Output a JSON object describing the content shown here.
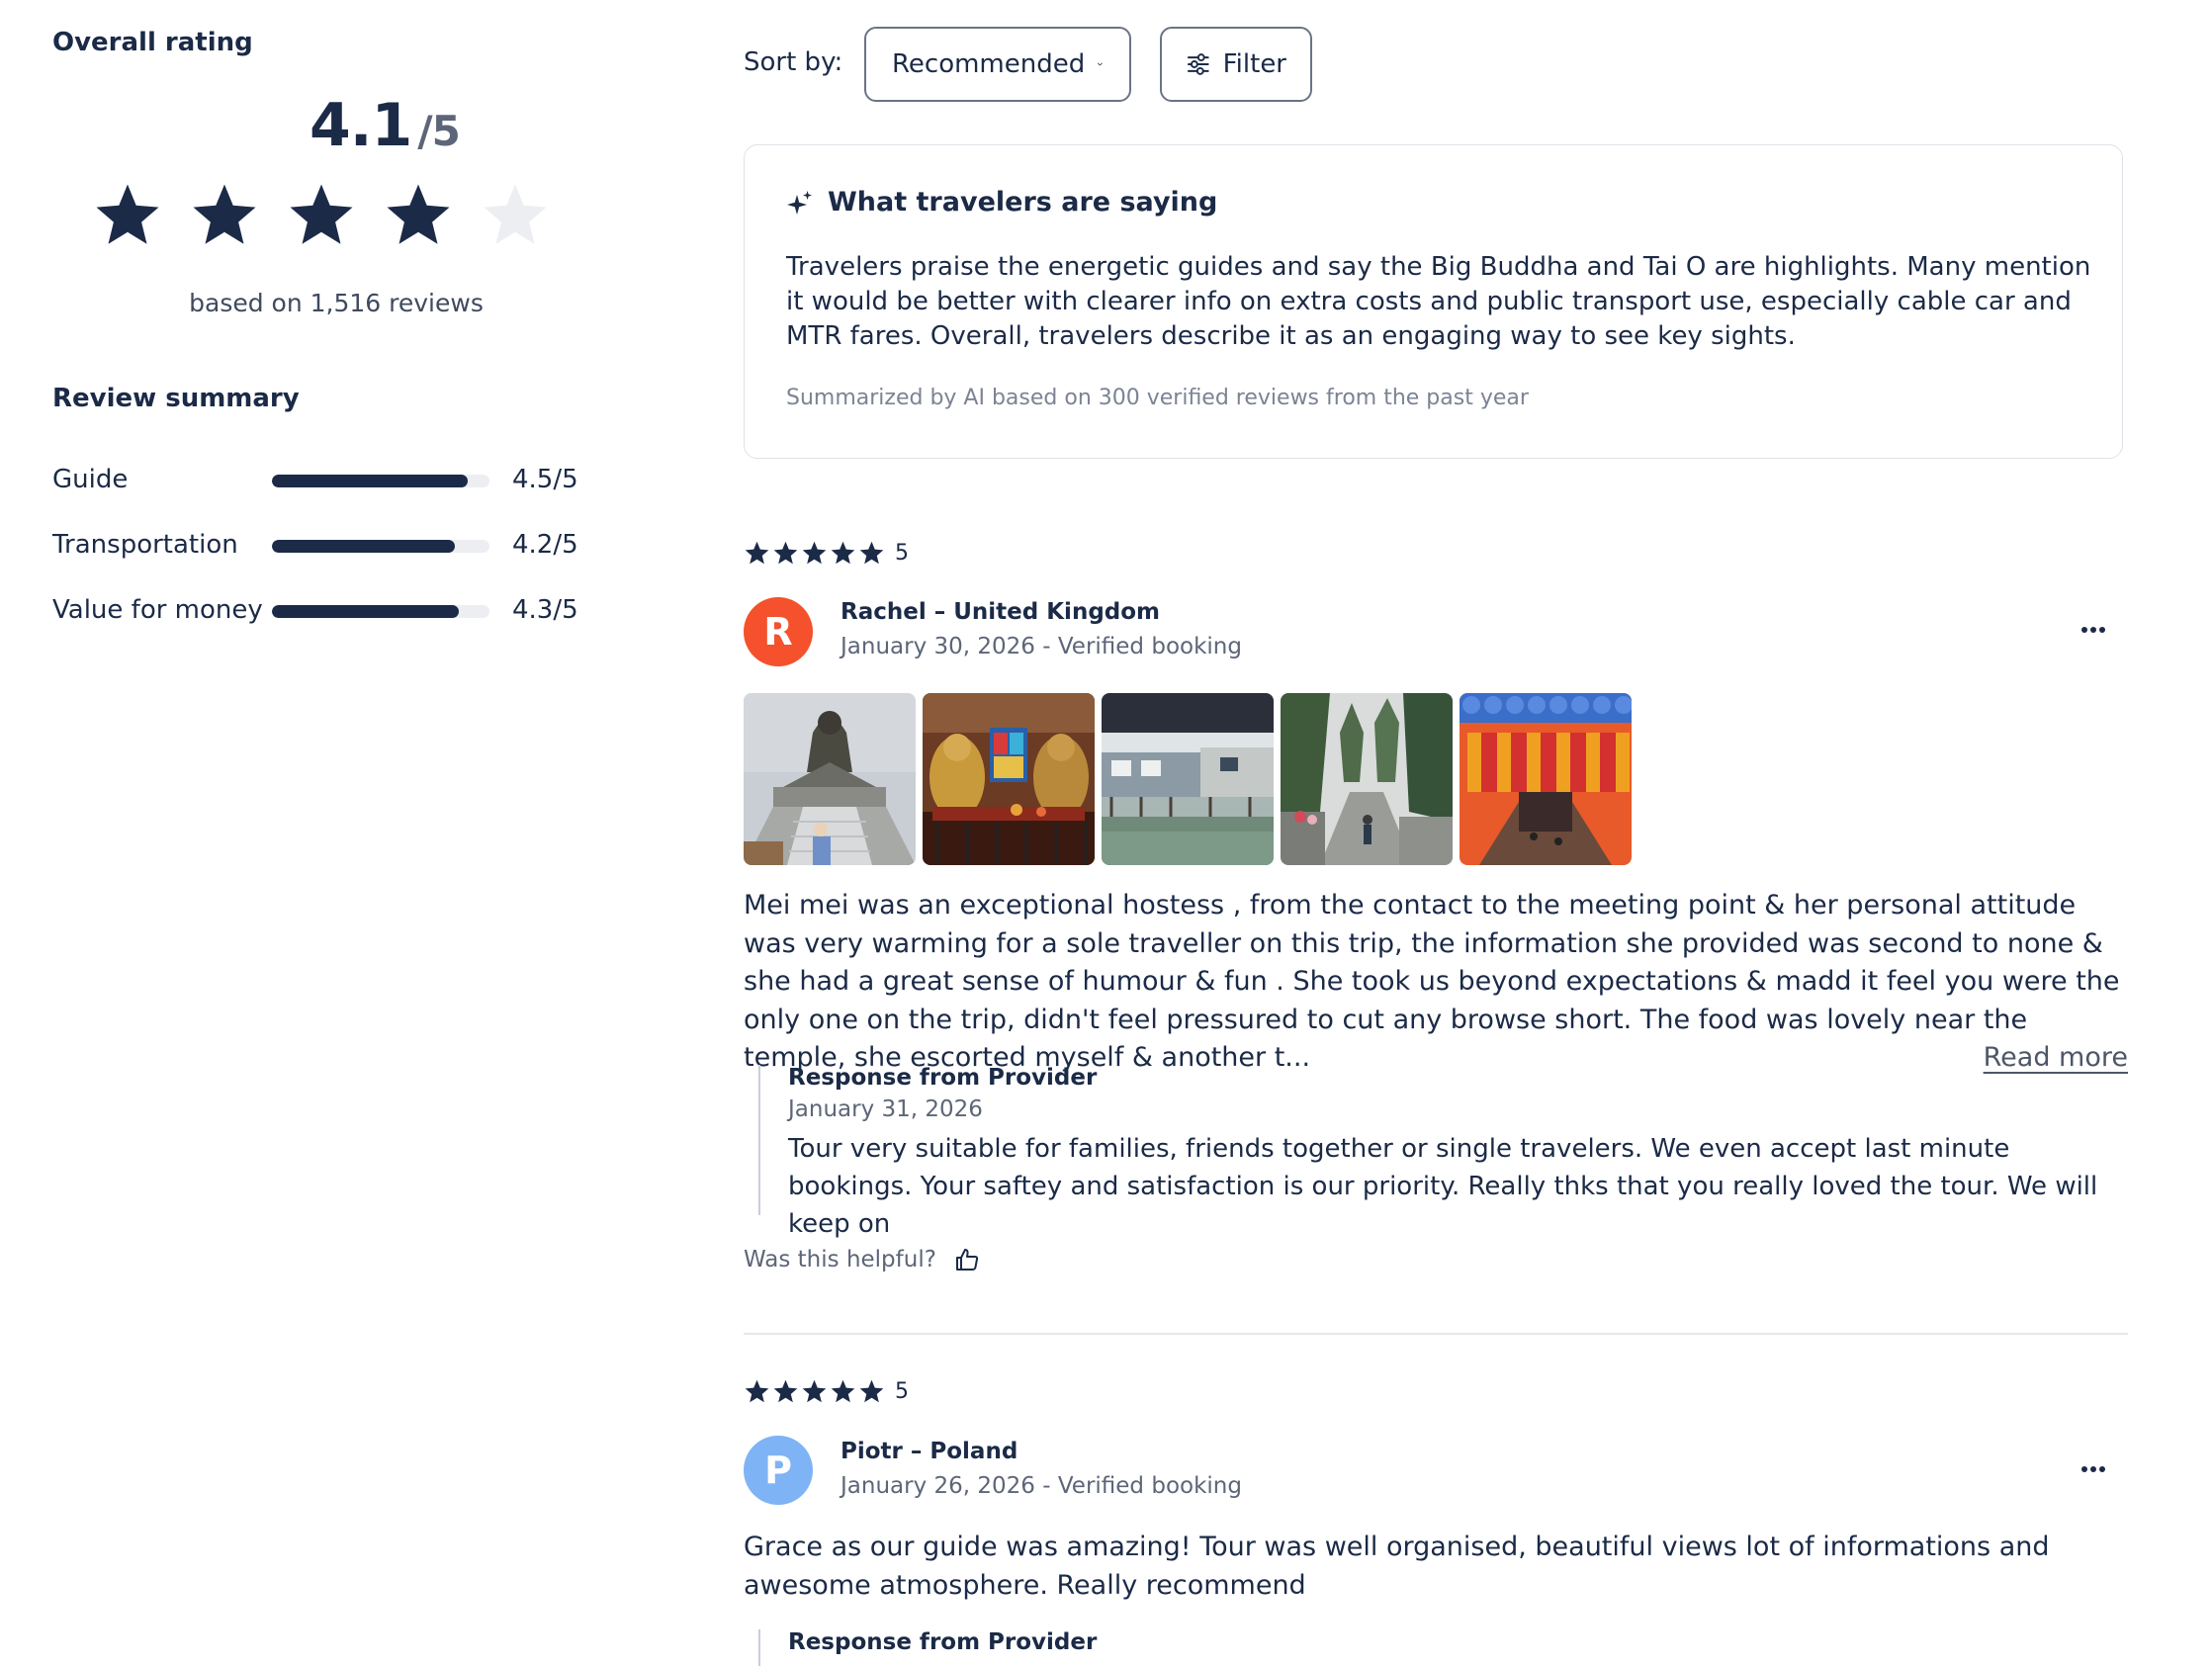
{
  "overall": {
    "heading": "Overall rating",
    "score": "4.1",
    "out_of": "/5",
    "star_value": 4.1,
    "based_on": "based on 1,516 reviews"
  },
  "summary": {
    "heading": "Review summary",
    "rows": [
      {
        "label": "Guide",
        "value": "4.5/5",
        "score": 4.5
      },
      {
        "label": "Transportation",
        "value": "4.2/5",
        "score": 4.2
      },
      {
        "label": "Value for money",
        "value": "4.3/5",
        "score": 4.3
      }
    ]
  },
  "toolbar": {
    "sort_label": "Sort by:",
    "sort_value": "Recommended",
    "filter_label": "Filter"
  },
  "ai_summary": {
    "title": "What travelers are saying",
    "body": "Travelers praise the energetic guides and say the Big Buddha and Tai O are highlights. Many mention it would be better with clearer info on extra costs and public transport use, especially cable car and MTR fares. Overall, travelers describe it as an engaging way to see key sights.",
    "footer": "Summarized by AI based on 300 verified reviews from the past year"
  },
  "reviews": [
    {
      "rating": "5",
      "avatar_letter": "R",
      "avatar_color": "#f4512c",
      "name": "Rachel – United Kingdom",
      "meta": "January 30, 2026 - Verified booking",
      "photos": [
        "big-buddha-photo",
        "temple-interior-photo",
        "tai-o-stilt-houses-photo",
        "mountain-trail-photo",
        "lanterns-photo"
      ],
      "text": "Mei mei was an exceptional hostess , from the contact to the meeting point & her personal attitude was very warming for a sole traveller on this trip, the information she provided was second to none & she had a great sense of humour & fun . She took us beyond expectations & madd it feel you were the only one on the trip, didn't feel pressured to cut any browse short. The food was lovely near the temple, she escorted myself & another t...",
      "read_more": "Read more",
      "response_title": "Response from Provider",
      "response_date": "January 31, 2026",
      "response_text": "Tour very suitable for families, friends together or single travelers. We even accept last minute bookings. Your saftey and satisfaction is our priority. Really thks that you really loved the tour. We will keep on",
      "helpful": "Was this helpful?"
    },
    {
      "rating": "5",
      "avatar_letter": "P",
      "avatar_color": "#7eb3f5",
      "name": "Piotr – Poland",
      "meta": "January 26, 2026 - Verified booking",
      "text": "Grace as our guide was amazing! Tour was well organised, beautiful views lot of informations and awesome atmosphere. Really recommend",
      "response_title": "Response from Provider"
    }
  ],
  "colors": {
    "navy": "#1b2a47",
    "muted": "#5d6678",
    "star_empty": "#eceef2"
  },
  "icons": [
    "star-icon",
    "chevron-down-icon",
    "filter-sliders-icon",
    "sparkle-icon",
    "more-dots-icon",
    "thumbs-up-icon"
  ]
}
